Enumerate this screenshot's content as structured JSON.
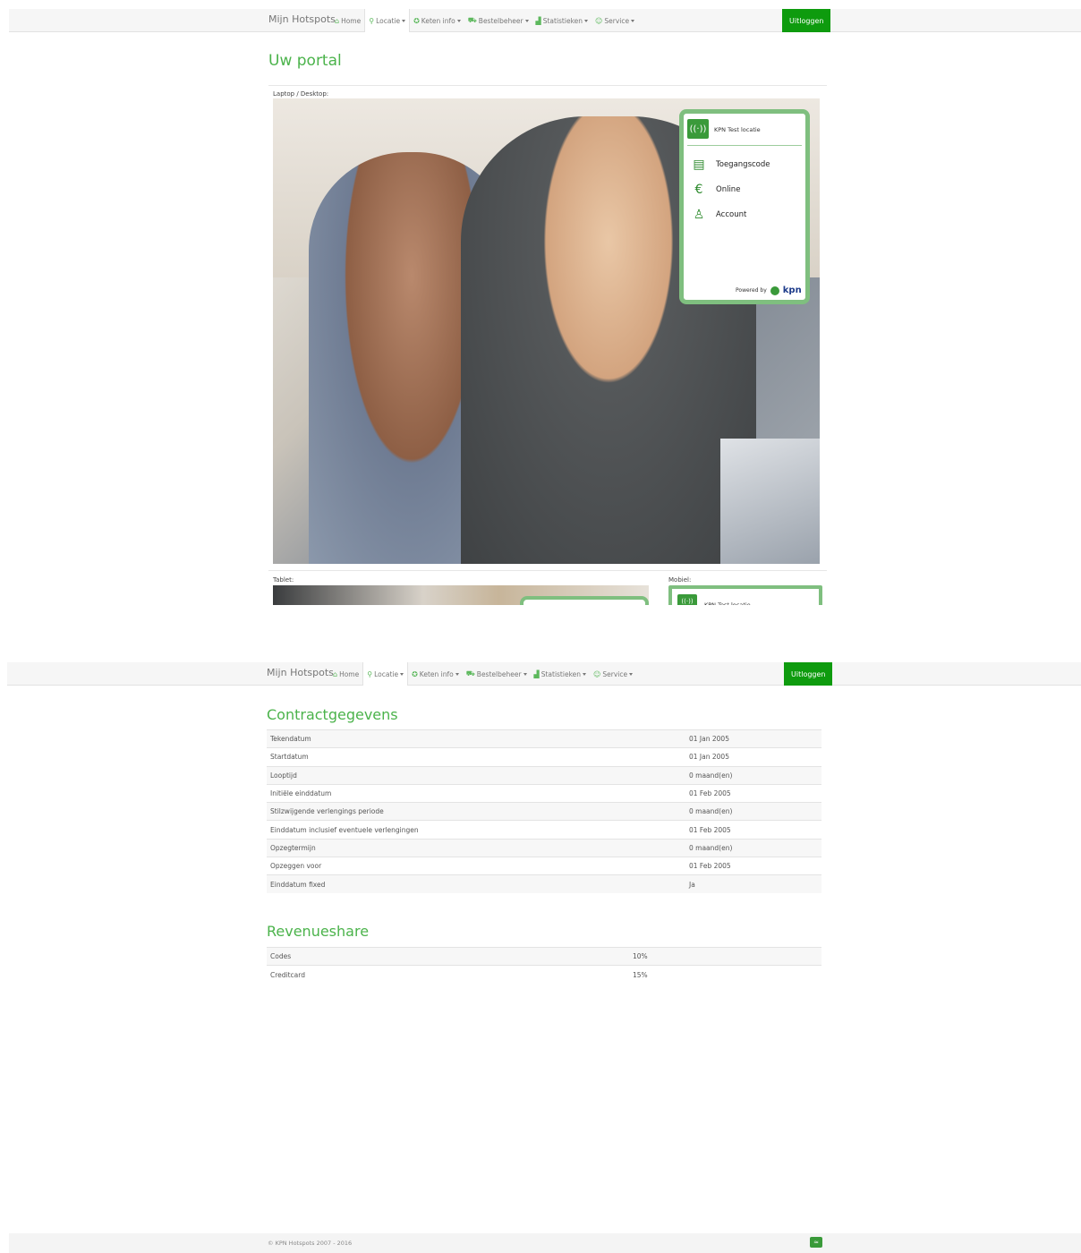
{
  "nav": {
    "brand": "Mijn Hotspots",
    "items": [
      {
        "label": "Home",
        "icon": "home-icon",
        "glyph": "⌂"
      },
      {
        "label": "Locatie",
        "icon": "map-pin-icon",
        "glyph": "⚲"
      },
      {
        "label": "Keten info",
        "icon": "network-icon",
        "glyph": "✪"
      },
      {
        "label": "Bestelbeheer",
        "icon": "cart-icon",
        "glyph": "⛟"
      },
      {
        "label": "Statistieken",
        "icon": "bar-chart-icon",
        "glyph": "▟"
      },
      {
        "label": "Service",
        "icon": "support-icon",
        "glyph": "☺"
      }
    ],
    "logout": "Uitloggen"
  },
  "portal": {
    "title": "Uw portal",
    "desktop_label": "Laptop / Desktop:",
    "tablet_label": "Tablet:",
    "mobile_label": "Mobiel:",
    "card": {
      "location": "KPN Test locatie",
      "options": [
        "Toegangscode",
        "Online",
        "Account"
      ],
      "powered_by": "Powered by",
      "brand": "kpn"
    }
  },
  "contract": {
    "title": "Contractgegevens",
    "rows": [
      [
        "Tekendatum",
        "01 Jan 2005"
      ],
      [
        "Startdatum",
        "01 Jan 2005"
      ],
      [
        "Looptijd",
        "0 maand(en)"
      ],
      [
        "Initiële einddatum",
        "01 Feb 2005"
      ],
      [
        "Stilzwijgende verlengings periode",
        "0 maand(en)"
      ],
      [
        "Einddatum inclusief eventuele verlengingen",
        "01 Feb 2005"
      ],
      [
        "Opzegtermijn",
        "0 maand(en)"
      ],
      [
        "Opzeggen voor",
        "01 Feb 2005"
      ],
      [
        "Einddatum fixed",
        "Ja"
      ]
    ]
  },
  "revenue": {
    "title": "Revenueshare",
    "rows": [
      [
        "Codes",
        "10%"
      ],
      [
        "Creditcard",
        "15%"
      ]
    ]
  },
  "footer": {
    "copyright": "© KPN Hotspots 2007 - 2016"
  },
  "colors": {
    "accent": "#4bb34b",
    "logout_bg": "#0e9b0e",
    "card_border": "#7fbf7f"
  }
}
